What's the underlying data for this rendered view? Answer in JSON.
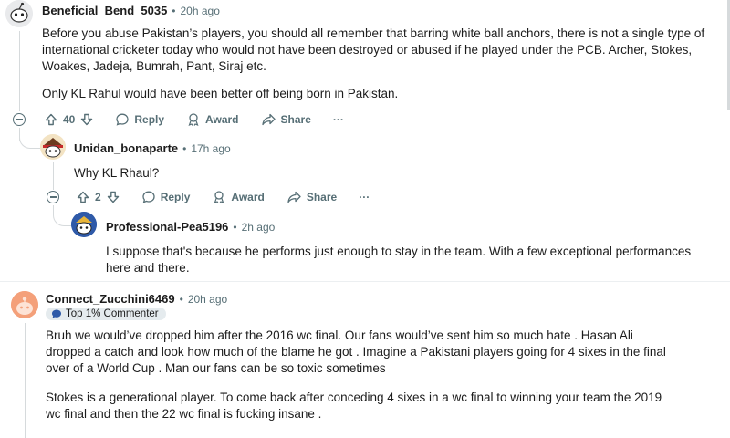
{
  "comments": [
    {
      "username": "Beneficial_Bend_5035",
      "time": "20h ago",
      "paragraphs": [
        "Before you abuse Pakistan’s players, you should all remember that barring white ball anchors, there is not a single type of international cricketer today who would not have been destroyed or abused if he played under the PCB. Archer, Stokes, Woakes, Jadeja, Bumrah, Pant, Siraj etc.",
        "Only KL Rahul would have been better off being born in Pakistan."
      ],
      "votes": "40",
      "actions": {
        "reply": "Reply",
        "award": "Award",
        "share": "Share",
        "more": "···"
      }
    },
    {
      "username": "Unidan_bonaparte",
      "time": "17h ago",
      "paragraphs": [
        "Why KL Rhaul?"
      ],
      "votes": "2",
      "actions": {
        "reply": "Reply",
        "award": "Award",
        "share": "Share",
        "more": "···"
      }
    },
    {
      "username": "Professional-Pea5196",
      "time": "2h ago",
      "paragraphs": [
        "I suppose that's because he performs just enough to stay in the team. With a few exceptional performances here and there."
      ]
    },
    {
      "username": "Connect_Zucchini6469",
      "time": "20h ago",
      "badge": "Top 1% Commenter",
      "paragraphs": [
        "Bruh we would’ve dropped him after the 2016 wc final. Our fans would’ve sent him so much hate . Hasan Ali dropped a catch and look how much of the blame he got . Imagine a Pakistani players going for 4 sixes in the final over of a World Cup . Man our fans can be so toxic sometimes",
        "Stokes is a generational player. To come back after conceding 4 sixes in a wc final to winning your team the 2019 wc final and then the 22 wc final is fucking insane ."
      ]
    }
  ],
  "separator": "•",
  "colors": {
    "text": "#1c1c1c",
    "meta": "#576f76",
    "thread": "#d6dadc",
    "badge_bg": "#e5ebee",
    "avatar_orange": "#f4a07a"
  }
}
